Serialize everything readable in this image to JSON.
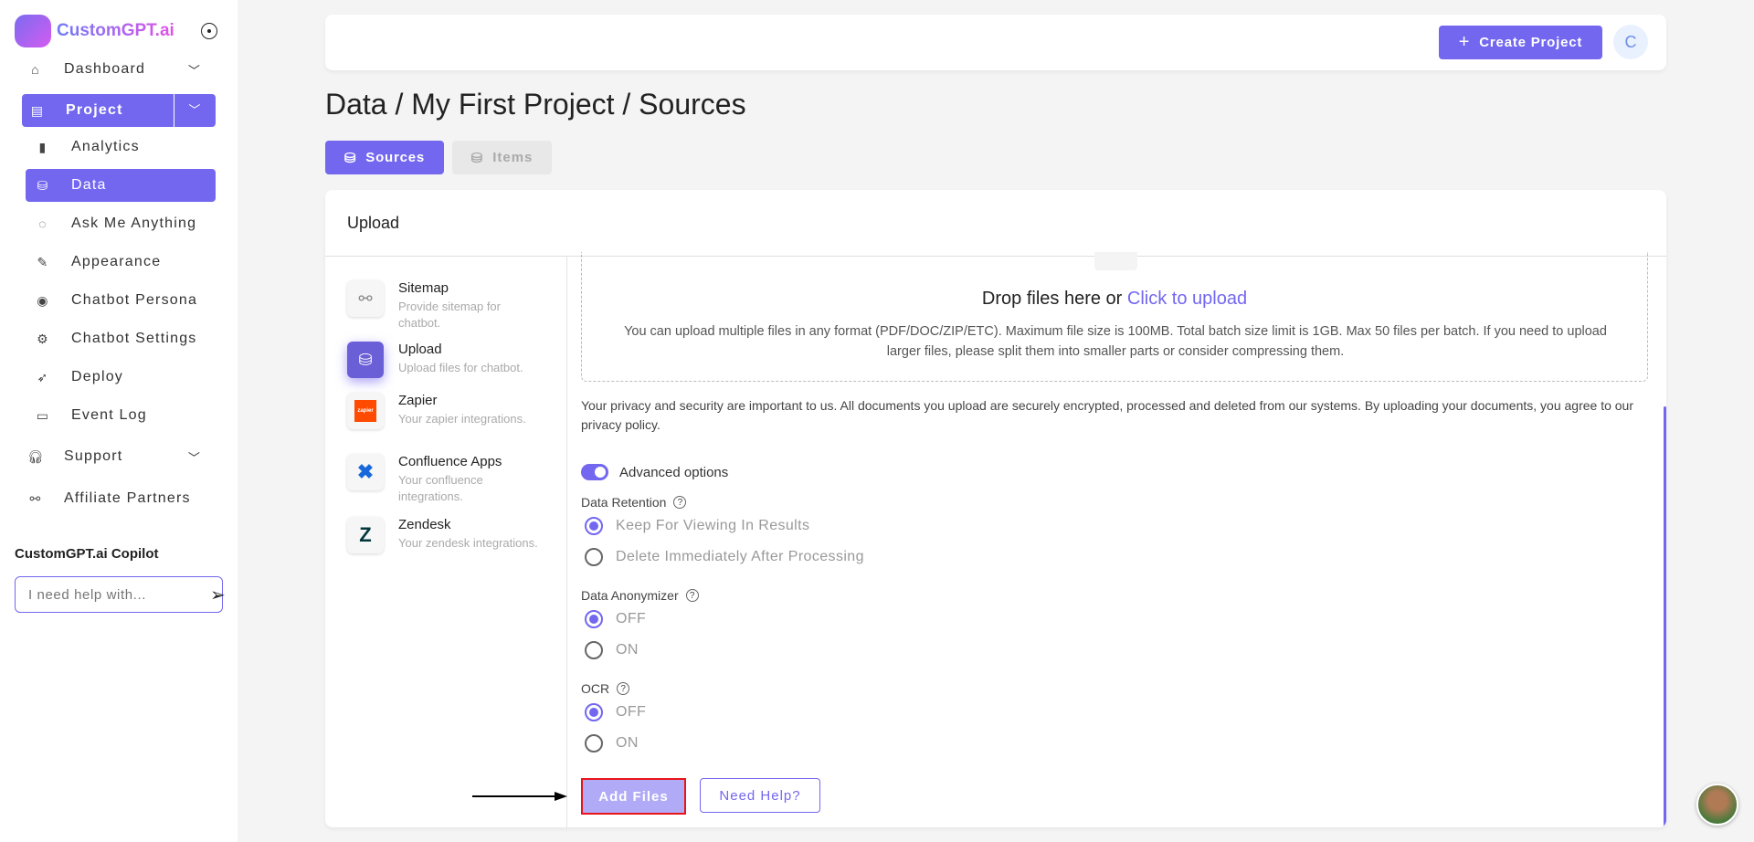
{
  "brand": {
    "name": "CustomGPT.ai"
  },
  "sidebar": {
    "dashboard": "Dashboard",
    "project": "Project",
    "items": [
      {
        "label": "Analytics",
        "icon": "bar-chart-icon"
      },
      {
        "label": "Data",
        "icon": "database-icon"
      },
      {
        "label": "Ask Me Anything",
        "icon": "chat-icon"
      },
      {
        "label": "Appearance",
        "icon": "brush-icon"
      },
      {
        "label": "Chatbot Persona",
        "icon": "user-circle-icon"
      },
      {
        "label": "Chatbot Settings",
        "icon": "gear-icon"
      },
      {
        "label": "Deploy",
        "icon": "rocket-icon"
      },
      {
        "label": "Event Log",
        "icon": "archive-icon"
      }
    ],
    "support": "Support",
    "affiliate": "Affiliate Partners",
    "copilot_label": "CustomGPT.ai Copilot",
    "copilot_placeholder": "I need help with..."
  },
  "header": {
    "create_project": "Create Project",
    "avatar_initial": "C"
  },
  "page": {
    "title": "Data / My First Project / Sources",
    "tabs": [
      {
        "label": "Sources",
        "active": true
      },
      {
        "label": "Items",
        "active": false
      }
    ]
  },
  "upload": {
    "heading": "Upload",
    "sources": [
      {
        "title": "Sitemap",
        "desc": "Provide sitemap for chatbot."
      },
      {
        "title": "Upload",
        "desc": "Upload files for chatbot."
      },
      {
        "title": "Zapier",
        "desc": "Your zapier integrations.",
        "logo": "zapier"
      },
      {
        "title": "Confluence Apps",
        "desc": "Your confluence integrations."
      },
      {
        "title": "Zendesk",
        "desc": "Your zendesk integrations."
      }
    ],
    "drop_text": "Drop files here or ",
    "click_text": "Click to upload",
    "drop_desc": "You can upload multiple files in any format (PDF/DOC/ZIP/ETC). Maximum file size is 100MB. Total batch size limit is 1GB. Max 50 files per batch. If you need to upload larger files, please split them into smaller parts or consider compressing them.",
    "privacy": "Your privacy and security are important to us. All documents you upload are securely encrypted, processed and deleted from our systems. By uploading your documents, you agree to our privacy policy.",
    "advanced": "Advanced options",
    "advanced_on": true,
    "retention": {
      "label": "Data Retention",
      "options": [
        "Keep For Viewing In Results",
        "Delete Immediately After Processing"
      ],
      "selected": 0
    },
    "anonymizer": {
      "label": "Data Anonymizer",
      "options": [
        "OFF",
        "ON"
      ],
      "selected": 0
    },
    "ocr": {
      "label": "OCR",
      "options": [
        "OFF",
        "ON"
      ],
      "selected": 0
    },
    "add_files": "Add Files",
    "need_help": "Need Help?"
  },
  "colors": {
    "accent": "#7367f0",
    "highlight": "#e8141b"
  }
}
